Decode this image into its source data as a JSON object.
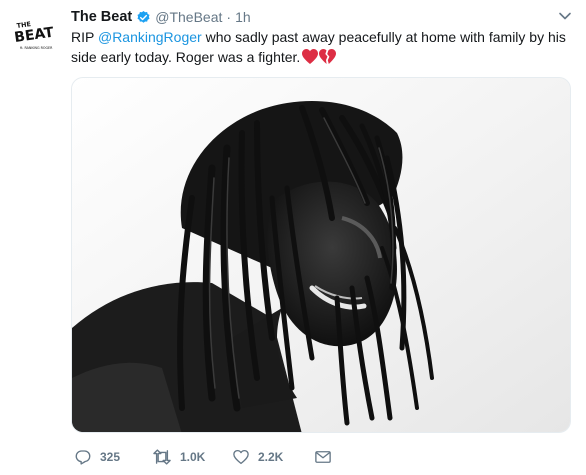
{
  "tweet": {
    "display_name": "The Beat",
    "handle": "@TheBeat",
    "separator": "·",
    "time": "1h",
    "text_pre": "RIP ",
    "mention": "@RankingRoger",
    "text_post": " who sadly past away peacefully at home with family by his side early today. Roger was a fighter.",
    "avatar_text_top": "THE",
    "avatar_text_main": "BEAT",
    "avatar_text_sub": "ft. RANKING ROGER"
  },
  "actions": {
    "replies": "325",
    "retweets": "1.0K",
    "likes": "2.2K"
  },
  "colors": {
    "accent": "#1b95e0",
    "muted": "#657786",
    "heart_red": "#dd2e44"
  },
  "icons": {
    "verified": "verified-badge-icon",
    "caret": "chevron-down-icon",
    "reply": "reply-icon",
    "retweet": "retweet-icon",
    "like": "heart-icon",
    "dm": "envelope-icon",
    "hearts": "red-heart-and-broken-heart-emoji"
  }
}
